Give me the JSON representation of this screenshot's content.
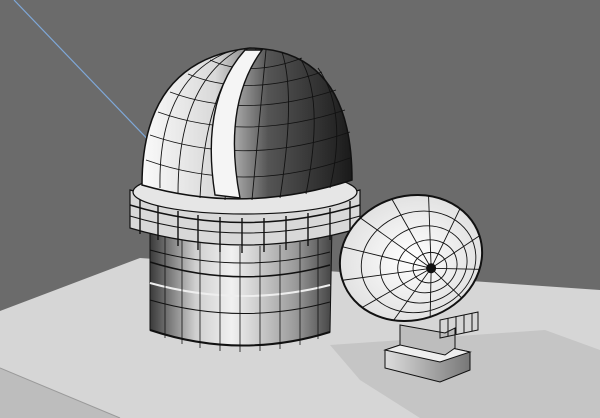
{
  "viewport": {
    "background": "#6b6b6b",
    "ground_color": "#d6d6d6",
    "shadow_color": "#a9a9a9",
    "wire_color": "#111111",
    "highlight_color": "#f2f2f2",
    "ray_color": "#7fa8d8"
  },
  "scene": {
    "objects": [
      {
        "name": "observatory-dome"
      },
      {
        "name": "observatory-drum"
      },
      {
        "name": "radio-dish"
      },
      {
        "name": "dish-pedestal"
      },
      {
        "name": "ground-plane"
      },
      {
        "name": "light-ray"
      }
    ]
  }
}
